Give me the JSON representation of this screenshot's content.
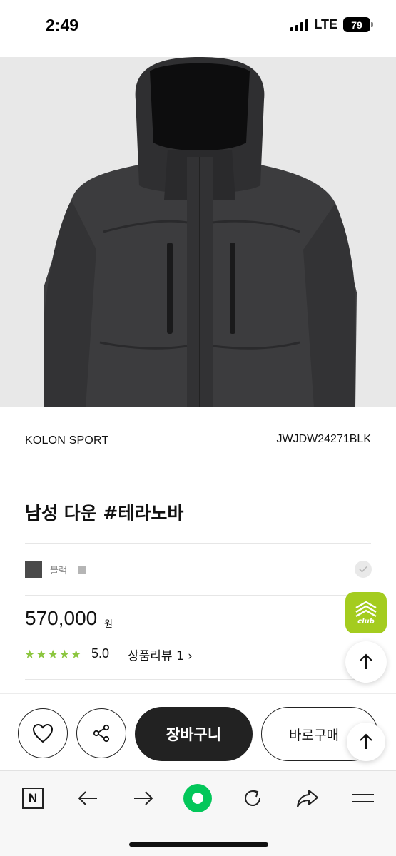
{
  "status_bar": {
    "time": "2:49",
    "network": "LTE",
    "battery": "79"
  },
  "product": {
    "brand": "KOLON SPORT",
    "sku": "JWJDW24271BLK",
    "title": "남성 다운 #테라노바",
    "color_label": "블랙",
    "price": "570,000",
    "price_unit": "원",
    "rating": "5.0",
    "review_link": "상품리뷰 1 ›",
    "star_count": 5
  },
  "badge": {
    "club_text": "club"
  },
  "actions": {
    "cart_label": "장바구니",
    "buy_label": "바로구매"
  },
  "browser_toolbar": {
    "n_label": "N"
  },
  "colors": {
    "accent_green": "#8cc63f",
    "club_green": "#a4cc1f",
    "naver_green": "#03c75a",
    "swatch_black": "#4a4a4a"
  }
}
